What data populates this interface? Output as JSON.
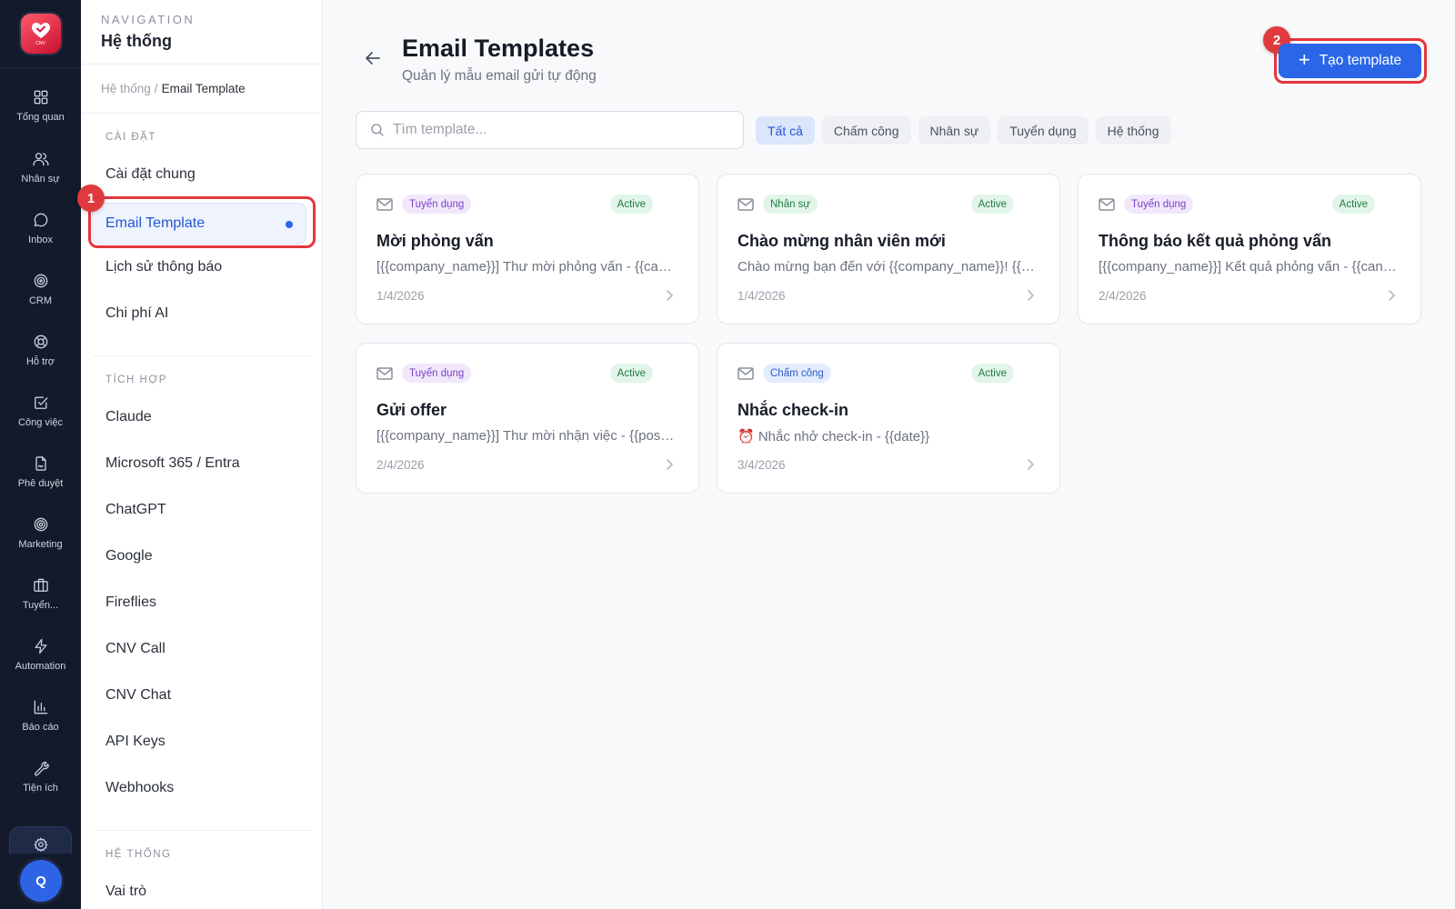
{
  "rail": {
    "logo_text": "CNV",
    "items": [
      {
        "label": "Tổng quan",
        "icon": "grid-icon"
      },
      {
        "label": "Nhân sự",
        "icon": "users-icon"
      },
      {
        "label": "Inbox",
        "icon": "chat-bubble-icon"
      },
      {
        "label": "CRM",
        "icon": "target-icon"
      },
      {
        "label": "Hỗ trợ",
        "icon": "lifebuoy-icon"
      },
      {
        "label": "Công việc",
        "icon": "checkbox-icon"
      },
      {
        "label": "Phê duyệt",
        "icon": "file-signature-icon"
      },
      {
        "label": "Marketing",
        "icon": "bullseye-icon"
      },
      {
        "label": "Tuyển...",
        "icon": "briefcase-icon"
      },
      {
        "label": "Automation",
        "icon": "lightning-icon"
      },
      {
        "label": "Báo cáo",
        "icon": "bar-chart-icon"
      },
      {
        "label": "Tiện ích",
        "icon": "wrench-icon"
      }
    ],
    "active_icon": "settings-gear-icon",
    "avatar_letter": "Q"
  },
  "nav": {
    "eyebrow": "NAVIGATION",
    "title": "Hệ thống",
    "breadcrumb": {
      "parent": "Hệ thống",
      "separator": "/",
      "current": "Email Template"
    },
    "sections": [
      {
        "heading": "CÀI ĐẶT",
        "items": [
          "Cài đặt chung",
          "Email Template",
          "Lịch sử thông báo",
          "Chi phí AI"
        ]
      },
      {
        "heading": "TÍCH HỢP",
        "items": [
          "Claude",
          "Microsoft 365 / Entra",
          "ChatGPT",
          "Google",
          "Fireflies",
          "CNV Call",
          "CNV Chat",
          "API Keys",
          "Webhooks"
        ]
      },
      {
        "heading": "HỆ THỐNG",
        "items": [
          "Vai trò"
        ]
      }
    ],
    "active_item": "Email Template"
  },
  "markers": {
    "first": "1",
    "second": "2"
  },
  "main": {
    "title": "Email Templates",
    "subtitle": "Quản lý mẫu email gửi tự động",
    "create_button": "Tạo template",
    "search_placeholder": "Tìm template...",
    "filters": [
      "Tất cả",
      "Chấm công",
      "Nhân sự",
      "Tuyển dụng",
      "Hệ thống"
    ],
    "active_filter": "Tất cả",
    "cards": [
      {
        "category": "Tuyển dụng",
        "status": "Active",
        "title": "Mời phỏng vấn",
        "preview": "[{{company_name}}] Thư mời phỏng vấn - {{candidate_name}}",
        "date": "1/4/2026"
      },
      {
        "category": "Nhân sự",
        "status": "Active",
        "title": "Chào mừng nhân viên mới",
        "preview": "Chào mừng bạn đến với {{company_name}}! {{employee_name}}",
        "date": "1/4/2026"
      },
      {
        "category": "Tuyển dụng",
        "status": "Active",
        "title": "Thông báo kết quả phỏng vấn",
        "preview": "[{{company_name}}] Kết quả phỏng vấn - {{candidate_name}}",
        "date": "2/4/2026"
      },
      {
        "category": "Tuyển dụng",
        "status": "Active",
        "title": "Gửi offer",
        "preview": "[{{company_name}}] Thư mời nhận việc - {{position}}",
        "date": "2/4/2026"
      },
      {
        "category": "Chấm công",
        "status": "Active",
        "title": "Nhắc check-in",
        "preview": "⏰ Nhắc nhở check-in - {{date}}",
        "date": "3/4/2026"
      }
    ]
  },
  "colors": {
    "rail_bg": "#131a2b",
    "accent": "#2b66e8",
    "highlight": "#e5363d",
    "badge_recruit_bg": "#f1e8fc",
    "badge_recruit_fg": "#7b3fc8",
    "badge_hr_bg": "#e1f5e9",
    "badge_hr_fg": "#227a45",
    "badge_time_bg": "#e3ecfc",
    "badge_time_fg": "#2b5bc9",
    "status_bg": "#e1f5e9",
    "status_fg": "#227a45"
  }
}
